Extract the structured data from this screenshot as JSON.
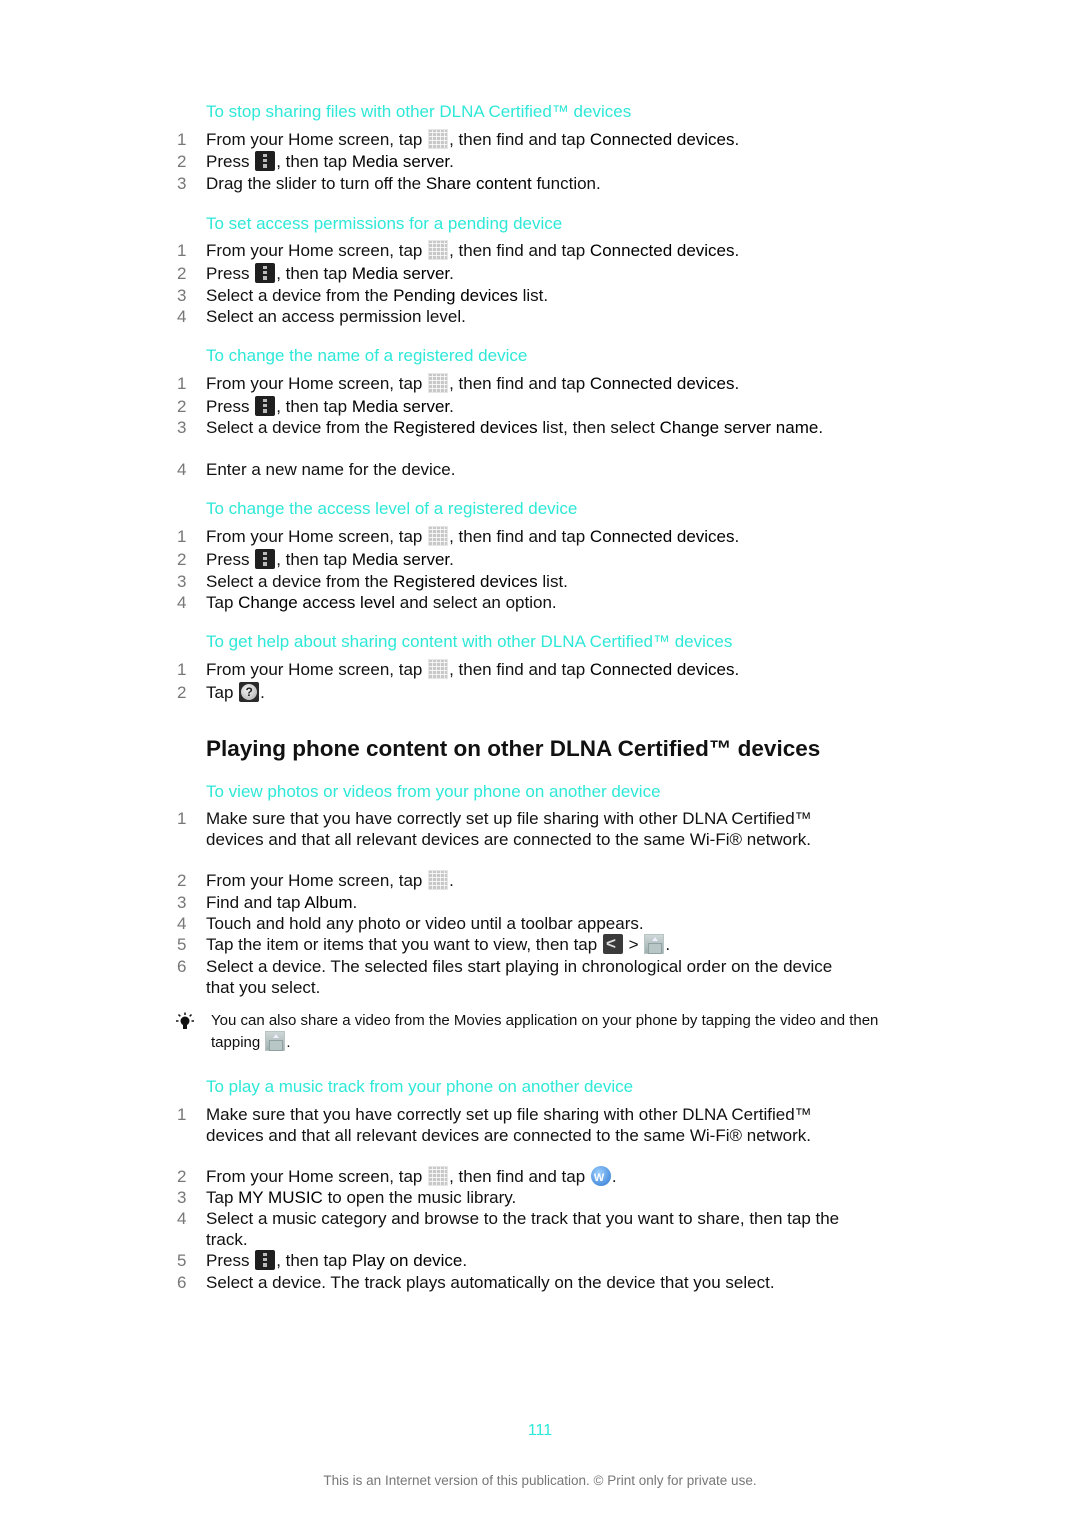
{
  "sections": [
    {
      "title": "To stop sharing files with other DLNA Certified™ devices",
      "steps": [
        {
          "n": "1",
          "parts": [
            {
              "t": "From your Home screen, tap "
            },
            {
              "icon": "apps"
            },
            {
              "t": ", then find and tap "
            },
            {
              "b": "Connected devices"
            },
            {
              "t": "."
            }
          ]
        },
        {
          "n": "2",
          "parts": [
            {
              "t": "Press "
            },
            {
              "icon": "menu"
            },
            {
              "t": ", then tap "
            },
            {
              "b": "Media server"
            },
            {
              "t": "."
            }
          ]
        },
        {
          "n": "3",
          "parts": [
            {
              "t": "Drag the slider to turn off the "
            },
            {
              "b": "Share content"
            },
            {
              "t": " function."
            }
          ]
        }
      ]
    },
    {
      "title": "To set access permissions for a pending device",
      "steps": [
        {
          "n": "1",
          "parts": [
            {
              "t": "From your Home screen, tap "
            },
            {
              "icon": "apps"
            },
            {
              "t": ", then find and tap "
            },
            {
              "b": "Connected devices"
            },
            {
              "t": "."
            }
          ]
        },
        {
          "n": "2",
          "parts": [
            {
              "t": "Press "
            },
            {
              "icon": "menu"
            },
            {
              "t": ", then tap "
            },
            {
              "b": "Media server"
            },
            {
              "t": "."
            }
          ]
        },
        {
          "n": "3",
          "parts": [
            {
              "t": "Select a device from the "
            },
            {
              "b": "Pending devices"
            },
            {
              "t": " list."
            }
          ]
        },
        {
          "n": "4",
          "parts": [
            {
              "t": "Select an access permission level."
            }
          ]
        }
      ]
    },
    {
      "title": "To change the name of a registered device",
      "steps": [
        {
          "n": "1",
          "parts": [
            {
              "t": "From your Home screen, tap "
            },
            {
              "icon": "apps"
            },
            {
              "t": ", then find and tap "
            },
            {
              "b": "Connected devices"
            },
            {
              "t": "."
            }
          ]
        },
        {
          "n": "2",
          "parts": [
            {
              "t": "Press "
            },
            {
              "icon": "menu"
            },
            {
              "t": ", then tap "
            },
            {
              "b": "Media server"
            },
            {
              "t": "."
            }
          ]
        },
        {
          "n": "3",
          "parts": [
            {
              "t": "Select a device from the "
            },
            {
              "b": "Registered devices"
            },
            {
              "t": " list, then select "
            },
            {
              "b": "Change server name"
            },
            {
              "t": "."
            }
          ]
        },
        {
          "n": "4",
          "parts": [
            {
              "t": "Enter a new name for the device."
            }
          ]
        }
      ]
    },
    {
      "title": "To change the access level of a registered device",
      "steps": [
        {
          "n": "1",
          "parts": [
            {
              "t": "From your Home screen, tap "
            },
            {
              "icon": "apps"
            },
            {
              "t": ", then find and tap "
            },
            {
              "b": "Connected devices"
            },
            {
              "t": "."
            }
          ]
        },
        {
          "n": "2",
          "parts": [
            {
              "t": "Press "
            },
            {
              "icon": "menu"
            },
            {
              "t": ", then tap "
            },
            {
              "b": "Media server"
            },
            {
              "t": "."
            }
          ]
        },
        {
          "n": "3",
          "parts": [
            {
              "t": "Select a device from the "
            },
            {
              "b": "Registered devices"
            },
            {
              "t": " list."
            }
          ]
        },
        {
          "n": "4",
          "parts": [
            {
              "t": "Tap "
            },
            {
              "b": "Change access level"
            },
            {
              "t": " and select an option."
            }
          ]
        }
      ]
    },
    {
      "title": "To get help about sharing content with other DLNA Certified™ devices",
      "steps": [
        {
          "n": "1",
          "parts": [
            {
              "t": "From your Home screen, tap "
            },
            {
              "icon": "apps"
            },
            {
              "t": ", then find and tap "
            },
            {
              "b": "Connected devices"
            },
            {
              "t": "."
            }
          ]
        },
        {
          "n": "2",
          "parts": [
            {
              "t": "Tap "
            },
            {
              "icon": "help"
            },
            {
              "t": "."
            }
          ]
        }
      ]
    }
  ],
  "main_heading": "Playing phone content on other DLNA Certified™ devices",
  "sections2": [
    {
      "title": "To view photos or videos from your phone on another device",
      "steps": [
        {
          "n": "1",
          "parts": [
            {
              "t": "Make sure that you have correctly set up file sharing with other DLNA Certified™ devices and that all relevant devices are connected to the same Wi-Fi® network."
            }
          ]
        },
        {
          "n": "2",
          "parts": [
            {
              "t": "From your Home screen, tap "
            },
            {
              "icon": "apps"
            },
            {
              "t": "."
            }
          ]
        },
        {
          "n": "3",
          "parts": [
            {
              "t": "Find and tap "
            },
            {
              "b": "Album"
            },
            {
              "t": "."
            }
          ]
        },
        {
          "n": "4",
          "parts": [
            {
              "t": "Touch and hold any photo or video until a toolbar appears."
            }
          ]
        },
        {
          "n": "5",
          "parts": [
            {
              "t": "Tap the item or items that you want to view, then tap "
            },
            {
              "icon": "share"
            },
            {
              "t": " > "
            },
            {
              "icon": "play"
            },
            {
              "t": "."
            }
          ]
        },
        {
          "n": "6",
          "parts": [
            {
              "t": "Select a device. The selected files start playing in chronological order on the device that you select."
            }
          ]
        }
      ]
    }
  ],
  "tip": {
    "parts": [
      {
        "t": "You can also share a video from the Movies application on your phone by tapping the video and then tapping "
      },
      {
        "icon": "play"
      },
      {
        "t": "."
      }
    ]
  },
  "sections3": [
    {
      "title": "To play a music track from your phone on another device",
      "steps": [
        {
          "n": "1",
          "parts": [
            {
              "t": "Make sure that you have correctly set up file sharing with other DLNA Certified™ devices and that all relevant devices are connected to the same Wi-Fi® network."
            }
          ]
        },
        {
          "n": "2",
          "parts": [
            {
              "t": "From your Home screen, tap "
            },
            {
              "icon": "apps"
            },
            {
              "t": ", then find and tap "
            },
            {
              "icon": "walkman"
            },
            {
              "t": "."
            }
          ]
        },
        {
          "n": "3",
          "parts": [
            {
              "t": "Tap "
            },
            {
              "b": "MY MUSIC"
            },
            {
              "t": " to open the music library."
            }
          ]
        },
        {
          "n": "4",
          "parts": [
            {
              "t": "Select a music category and browse to the track that you want to share, then tap the track."
            }
          ]
        },
        {
          "n": "5",
          "parts": [
            {
              "t": "Press "
            },
            {
              "icon": "menu"
            },
            {
              "t": ", then tap "
            },
            {
              "b": "Play on device"
            },
            {
              "t": "."
            }
          ]
        },
        {
          "n": "6",
          "parts": [
            {
              "t": "Select a device. The track plays automatically on the device that you select."
            }
          ]
        }
      ]
    }
  ],
  "page_number": "111",
  "footer": "This is an Internet version of this publication. © Print only for private use.",
  "colors": {
    "heading_accent": "#2ee8d8",
    "step_number": "#777777",
    "body_text": "#111111"
  }
}
